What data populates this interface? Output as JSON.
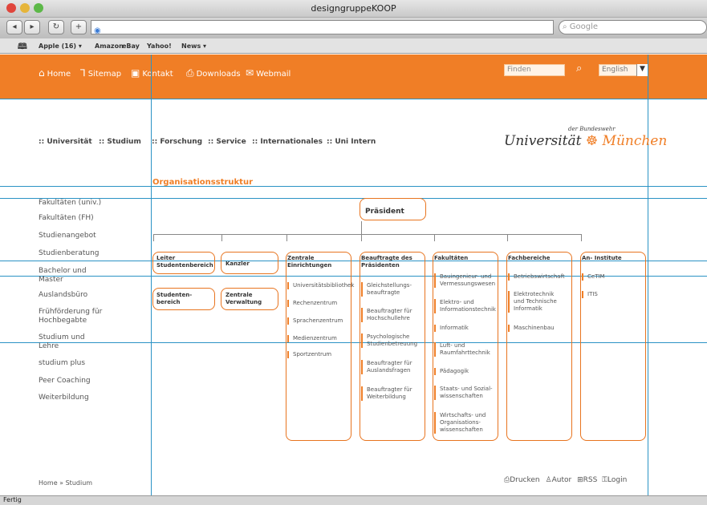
{
  "window": {
    "title": "designgruppeKOOP"
  },
  "browser": {
    "search_placeholder": "Google",
    "bookmarks": [
      "Apple (16) ▾",
      "Amazon",
      "eBay",
      "Yahoo!",
      "News ▾"
    ],
    "status": "Fertig"
  },
  "topnav": {
    "items": [
      "Home",
      "Sitemap",
      "Kontakt",
      "Downloads",
      "Webmail"
    ],
    "search_placeholder": "Finden",
    "language": "English"
  },
  "mainmenu": {
    "items": [
      ":: Universität",
      ":: Studium",
      ":: Forschung",
      ":: Service",
      ":: Internationales",
      ":: Uni Intern"
    ]
  },
  "logo": {
    "top": "der Bundeswehr",
    "main": "Universität",
    "city": "München"
  },
  "page": {
    "title": "Organisationsstruktur"
  },
  "sidebar": {
    "items": [
      "Fakultäten (univ.)",
      "Fakultäten (FH)",
      "Studienangebot",
      "Studienberatung",
      "Bachelor und Master",
      "Auslandsbüro",
      "Frühförderung für Hochbegabte",
      "Studium und Lehre",
      "studium plus",
      "Peer Coaching",
      "Weiterbildung"
    ]
  },
  "org": {
    "president": "Präsident",
    "leiter": "Leiter Studentenbereich",
    "kanzler": "Kanzler",
    "studentenbereich": "Studenten-bereich",
    "zentralverwaltung": "Zentrale Verwaltung",
    "columns": [
      {
        "title": "Zentrale Einrichtungen",
        "items": [
          "Universitätsbibliothek",
          "Rechenzentrum",
          "Sprachenzentrum",
          "Medienzentrum",
          "Sportzentrum"
        ]
      },
      {
        "title": "Beauftragte des Präsidenten",
        "items": [
          "Gleichstellungs-beauftragte",
          "Beauftragter für Hochschullehre",
          "Psychologische Studienbetreuung",
          "Beauftragter für Auslandsfragen",
          "Beauftragter für Weiterbildung"
        ]
      },
      {
        "title": "Fakultäten",
        "items": [
          "Bauingenieur- und Vermessungswesen",
          "Elektro- und Informationstechnik",
          "Informatik",
          "Luft- und Raumfahrttechnik",
          "Pädagogik",
          "Staats- und Sozial-wissenschaften",
          "Wirtschafts- und Organisations-wissenschaften"
        ]
      },
      {
        "title": "Fachbereiche",
        "items": [
          "Betriebswirtschaft",
          "Elektrotechnik und Technische Informatik",
          "Maschinenbau"
        ]
      },
      {
        "title": "An- Institute",
        "items": [
          "CeTIM",
          "ITIS"
        ]
      }
    ]
  },
  "footer": {
    "breadcrumb": "Home » Studium",
    "links": [
      "Drucken",
      "Autor",
      "RSS",
      "Login"
    ]
  }
}
